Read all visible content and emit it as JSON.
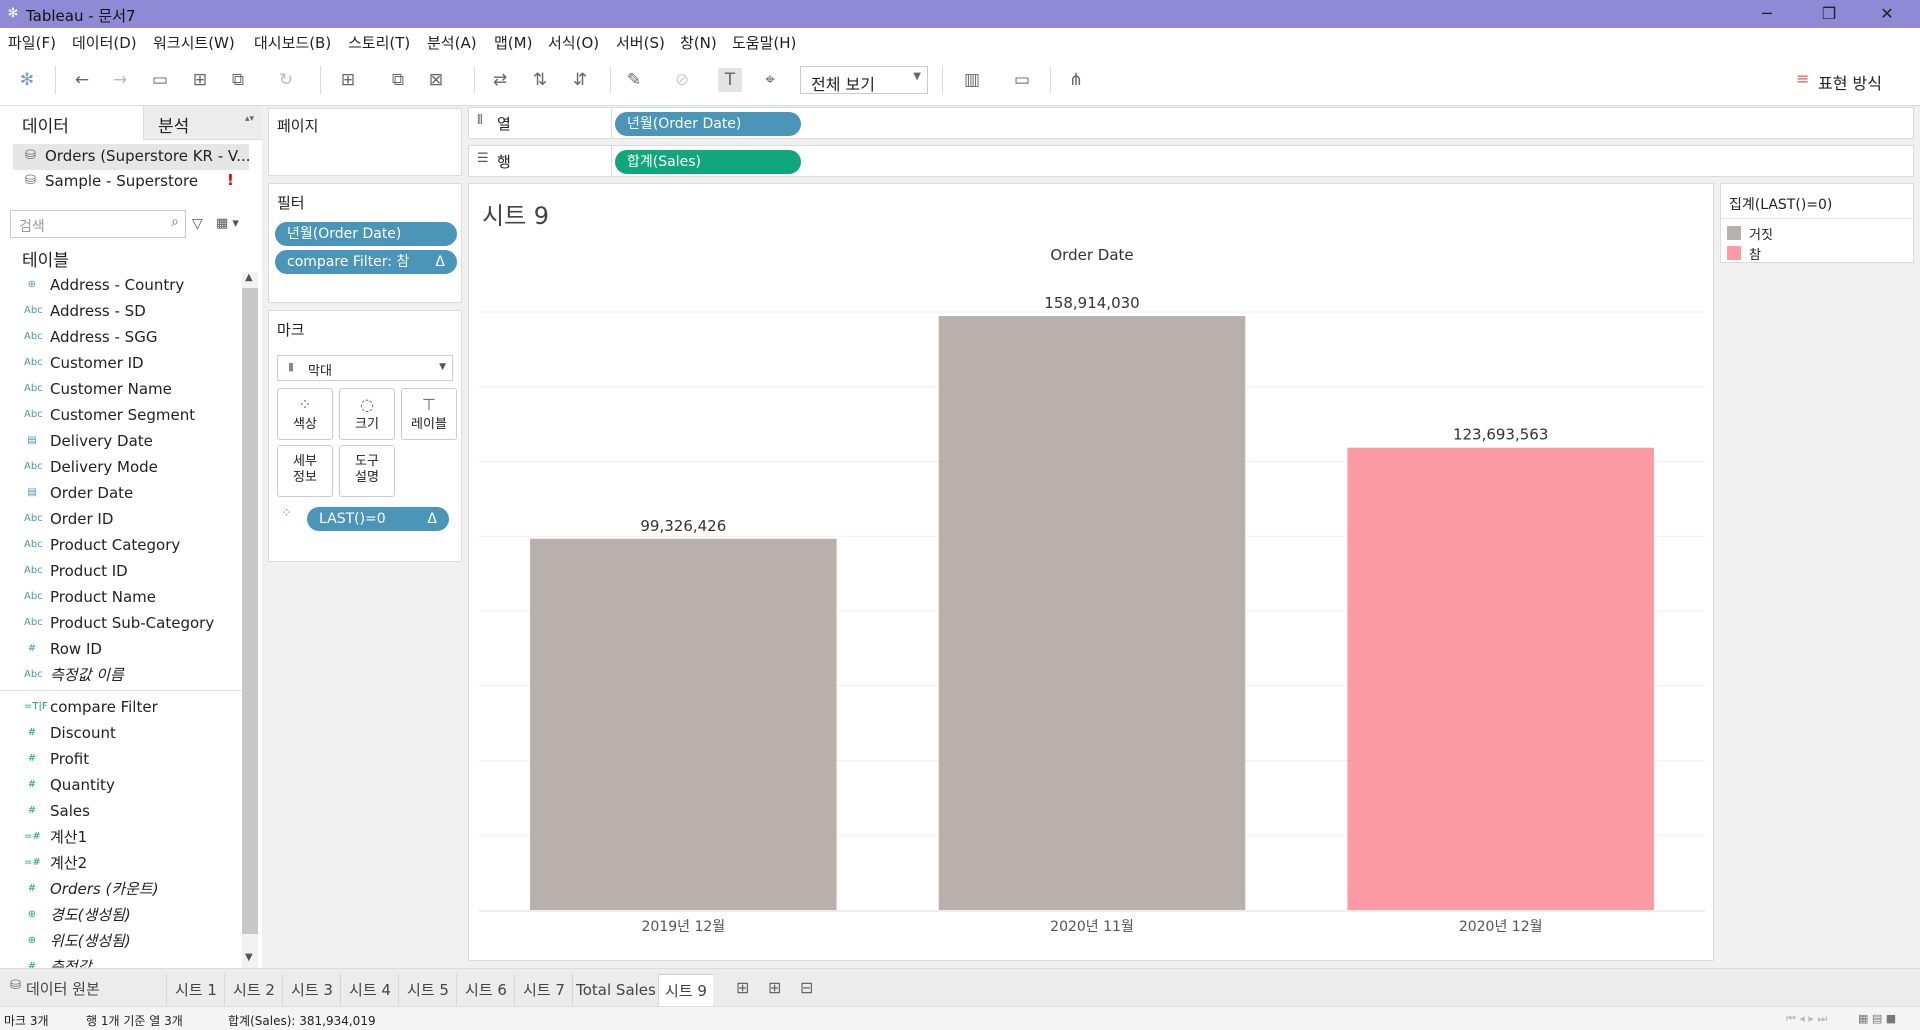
{
  "window": {
    "title": "Tableau - 문서7"
  },
  "menu": [
    "파일(F)",
    "데이터(D)",
    "워크시트(W)",
    "대시보드(B)",
    "스토리(T)",
    "분석(A)",
    "맵(M)",
    "서식(O)",
    "서버(S)",
    "창(N)",
    "도움말(H)"
  ],
  "toolbar": {
    "view_mode": "전체 보기",
    "show_me": "표현 방식"
  },
  "sidebar": {
    "tab_data": "데이터",
    "tab_analysis": "분석",
    "datasources": [
      "Orders (Superstore KR - V...",
      "Sample - Superstore"
    ],
    "datasource_warning": "!",
    "search_placeholder": "검색",
    "section_tables": "테이블",
    "dimensions": [
      {
        "icon": "⊕",
        "label": "Address - Country"
      },
      {
        "icon": "Abc",
        "label": "Address - SD"
      },
      {
        "icon": "Abc",
        "label": "Address - SGG"
      },
      {
        "icon": "Abc",
        "label": "Customer ID"
      },
      {
        "icon": "Abc",
        "label": "Customer Name"
      },
      {
        "icon": "Abc",
        "label": "Customer Segment"
      },
      {
        "icon": "▤",
        "label": "Delivery Date"
      },
      {
        "icon": "Abc",
        "label": "Delivery Mode"
      },
      {
        "icon": "▤",
        "label": "Order Date"
      },
      {
        "icon": "Abc",
        "label": "Order ID"
      },
      {
        "icon": "Abc",
        "label": "Product Category"
      },
      {
        "icon": "Abc",
        "label": "Product ID"
      },
      {
        "icon": "Abc",
        "label": "Product Name"
      },
      {
        "icon": "Abc",
        "label": "Product Sub-Category"
      },
      {
        "icon": "#",
        "label": "Row ID"
      },
      {
        "icon": "Abc",
        "label": "측정값 이름"
      }
    ],
    "measures": [
      {
        "icon": "=T|F",
        "label": "compare Filter"
      },
      {
        "icon": "#",
        "label": "Discount"
      },
      {
        "icon": "#",
        "label": "Profit"
      },
      {
        "icon": "#",
        "label": "Quantity"
      },
      {
        "icon": "#",
        "label": "Sales"
      },
      {
        "icon": "=#",
        "label": "계산1"
      },
      {
        "icon": "=#",
        "label": "계산2"
      },
      {
        "icon": "#",
        "label": "Orders (카운트)"
      },
      {
        "icon": "⊕",
        "label": "경도(생성됨)"
      },
      {
        "icon": "⊕",
        "label": "위도(생성됨)"
      },
      {
        "icon": "#",
        "label": "측정값"
      }
    ]
  },
  "cards": {
    "pages": "페이지",
    "filters_title": "필터",
    "filters": [
      "년월(Order Date)",
      "compare Filter: 참"
    ],
    "marks_title": "마크",
    "mark_type": "막대",
    "mark_buttons": [
      "색상",
      "크기",
      "레이블",
      "세부\n정보",
      "도구\n설명"
    ],
    "mark_pill": "LAST()=0",
    "delta": "Δ"
  },
  "shelves": {
    "columns_label": "열",
    "columns_pill": "년월(Order Date)",
    "rows_label": "행",
    "rows_pill": "합계(Sales)"
  },
  "sheet": {
    "title": "시트 9"
  },
  "legend": {
    "title": "집계(LAST()=0)",
    "items": [
      {
        "label": "거짓",
        "color": "#b9b0ab"
      },
      {
        "label": "참",
        "color": "#fd9ba5"
      }
    ]
  },
  "chart_data": {
    "type": "bar",
    "title": "Order Date",
    "categories": [
      "2019년 12월",
      "2020년 11월",
      "2020년 12월"
    ],
    "values": [
      99326426,
      158914030,
      123693563
    ],
    "value_labels": [
      "99,326,426",
      "158,914,030",
      "123,693,563"
    ],
    "colors": [
      "#b9b0ab",
      "#b9b0ab",
      "#fd9ba5"
    ],
    "ylim": [
      0,
      160000000
    ],
    "grid": true,
    "legend": "right"
  },
  "tabs": {
    "datasource": "데이터 원본",
    "sheets": [
      "시트 1",
      "시트 2",
      "시트 3",
      "시트 4",
      "시트 5",
      "시트 6",
      "시트 7",
      "Total Sales",
      "시트 9"
    ],
    "active": "시트 9"
  },
  "status": {
    "marks": "마크 3개",
    "rows_cols": "행 1개 기준 열 3개",
    "sum": "합계(Sales): 381,934,019"
  }
}
